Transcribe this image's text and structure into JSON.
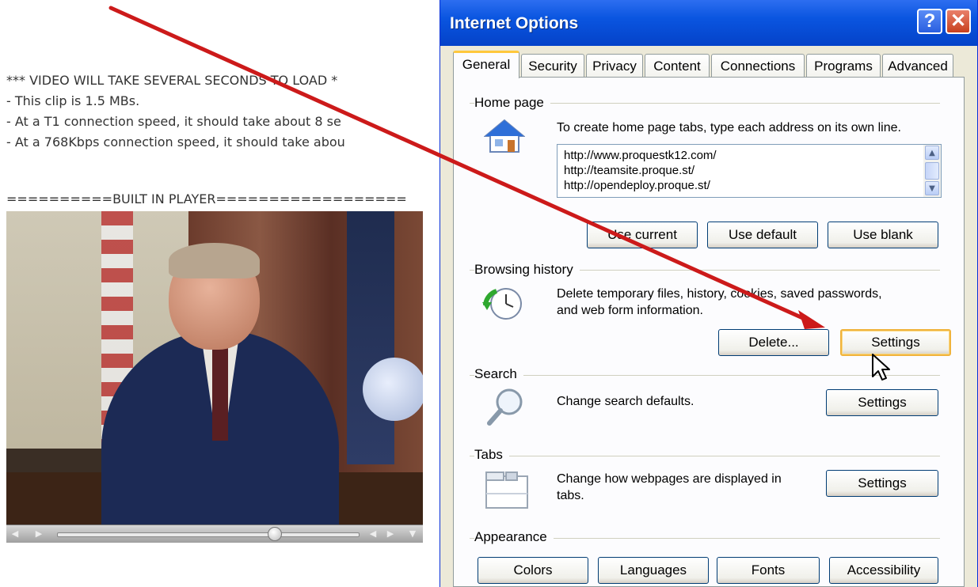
{
  "web_page": {
    "lines": [
      "*** VIDEO WILL TAKE SEVERAL SECONDS TO LOAD *",
      "- This clip is 1.5 MBs.",
      "- At a T1 connection speed, it should take about 8 se",
      "- At a 768Kbps connection speed, it should take abou"
    ],
    "player_header": "==========BUILT IN PLAYER=================="
  },
  "dialog": {
    "title": "Internet Options",
    "help_label": "?",
    "close_label": "✕",
    "tabs": [
      "General",
      "Security",
      "Privacy",
      "Content",
      "Connections",
      "Programs",
      "Advanced"
    ],
    "active_tab": "General",
    "home_page": {
      "label": "Home page",
      "description": "To create home page tabs, type each address on its own line.",
      "urls": [
        "http://www.proquestk12.com/",
        "http://teamsite.proque.st/",
        "http://opendeploy.proque.st/"
      ],
      "buttons": [
        "Use current",
        "Use default",
        "Use blank"
      ]
    },
    "browsing_history": {
      "label": "Browsing history",
      "description_line1": "Delete temporary files, history, cookies, saved passwords,",
      "description_line2": "and web form information.",
      "delete_label": "Delete...",
      "settings_label": "Settings"
    },
    "search": {
      "label": "Search",
      "description": "Change search defaults.",
      "settings_label": "Settings"
    },
    "tabs_section": {
      "label": "Tabs",
      "description_line1": "Change how webpages are displayed in",
      "description_line2": "tabs.",
      "settings_label": "Settings"
    },
    "appearance": {
      "label": "Appearance",
      "buttons": [
        "Colors",
        "Languages",
        "Fonts",
        "Accessibility"
      ]
    }
  },
  "annotation": {
    "arrow_color": "#cc1a1a"
  },
  "icons": [
    "house-icon",
    "history-clock-icon",
    "magnifier-icon",
    "tabs-window-icon",
    "mouse-cursor-icon"
  ]
}
